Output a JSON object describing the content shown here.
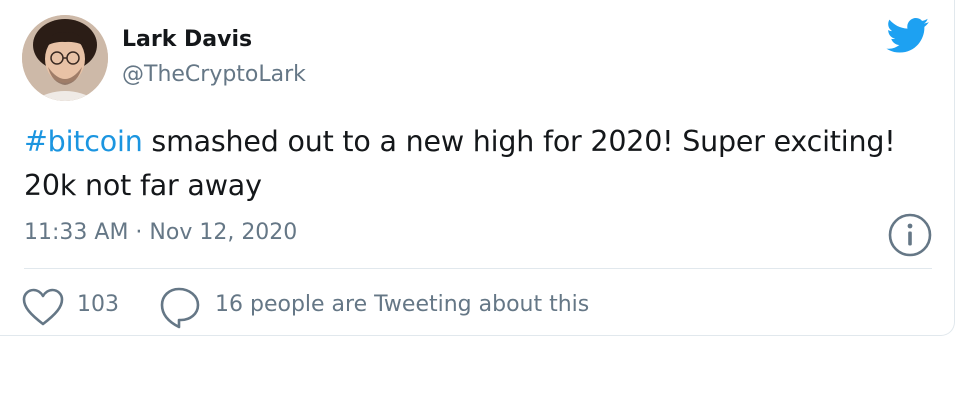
{
  "author": {
    "name": "Lark Davis",
    "handle": "@TheCryptoLark",
    "avatar_icon": "user-avatar"
  },
  "tweet": {
    "hashtag": "#bitcoin",
    "text_line1": " smashed out to a new high for 2020! Super exciting!",
    "text_line2": "20k not far away",
    "timestamp": "11:33 AM · Nov 12, 2020"
  },
  "actions": {
    "like_count": "103",
    "tweeting_label": "16 people are Tweeting about this"
  },
  "icons": {
    "brand": "twitter-bird-icon",
    "info": "info-icon",
    "like": "heart-icon",
    "reply": "speech-bubble-icon"
  },
  "colors": {
    "brand_blue": "#1da1f2",
    "hashtag_blue": "#1b95e0",
    "secondary_text": "#657786",
    "primary_text": "#14171a",
    "divider": "#e1e8ed"
  }
}
